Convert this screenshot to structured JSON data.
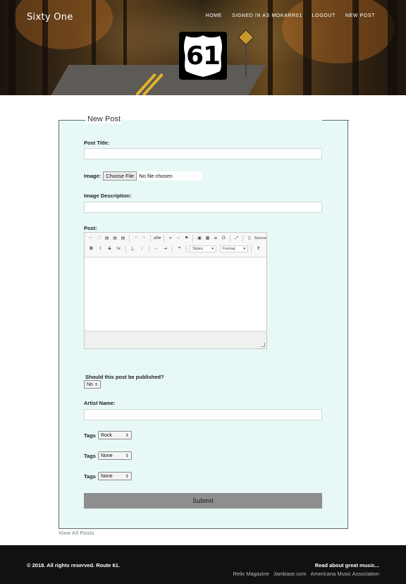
{
  "header": {
    "brand": "Sixty One",
    "nav": [
      "HOME",
      "SIGNED IN AS MOKARR01",
      "LOGOUT",
      "NEW POST"
    ],
    "logo_text": "61"
  },
  "form": {
    "legend": "New Post",
    "post_title_label": "Post Title:",
    "image_label": "Image:",
    "choose_file": "Choose File",
    "no_file": "No file chosen",
    "image_description_label": "Image Description:",
    "post_label": "Post:",
    "toolbar": {
      "source": "Source",
      "styles": "Styles",
      "format": "Format",
      "bold": "B",
      "italic": "I",
      "strike": "S",
      "help": "?",
      "omega": "Ω"
    },
    "publish_label": "Should this post be published?",
    "publish_value": "No",
    "artist_label": "Artist Name:",
    "tags": [
      {
        "label": "Tags",
        "value": "Rock"
      },
      {
        "label": "Tags",
        "value": "None"
      },
      {
        "label": "Tags",
        "value": "None"
      }
    ],
    "submit": "Submit"
  },
  "view_all": "View All Posts",
  "footer": {
    "copyright": "© 2018. All rights reserved. Route 61.",
    "read_about": "Read about great music...",
    "links": [
      "Relix Magazine",
      "Jambase.com",
      "Americana Music Association"
    ]
  }
}
